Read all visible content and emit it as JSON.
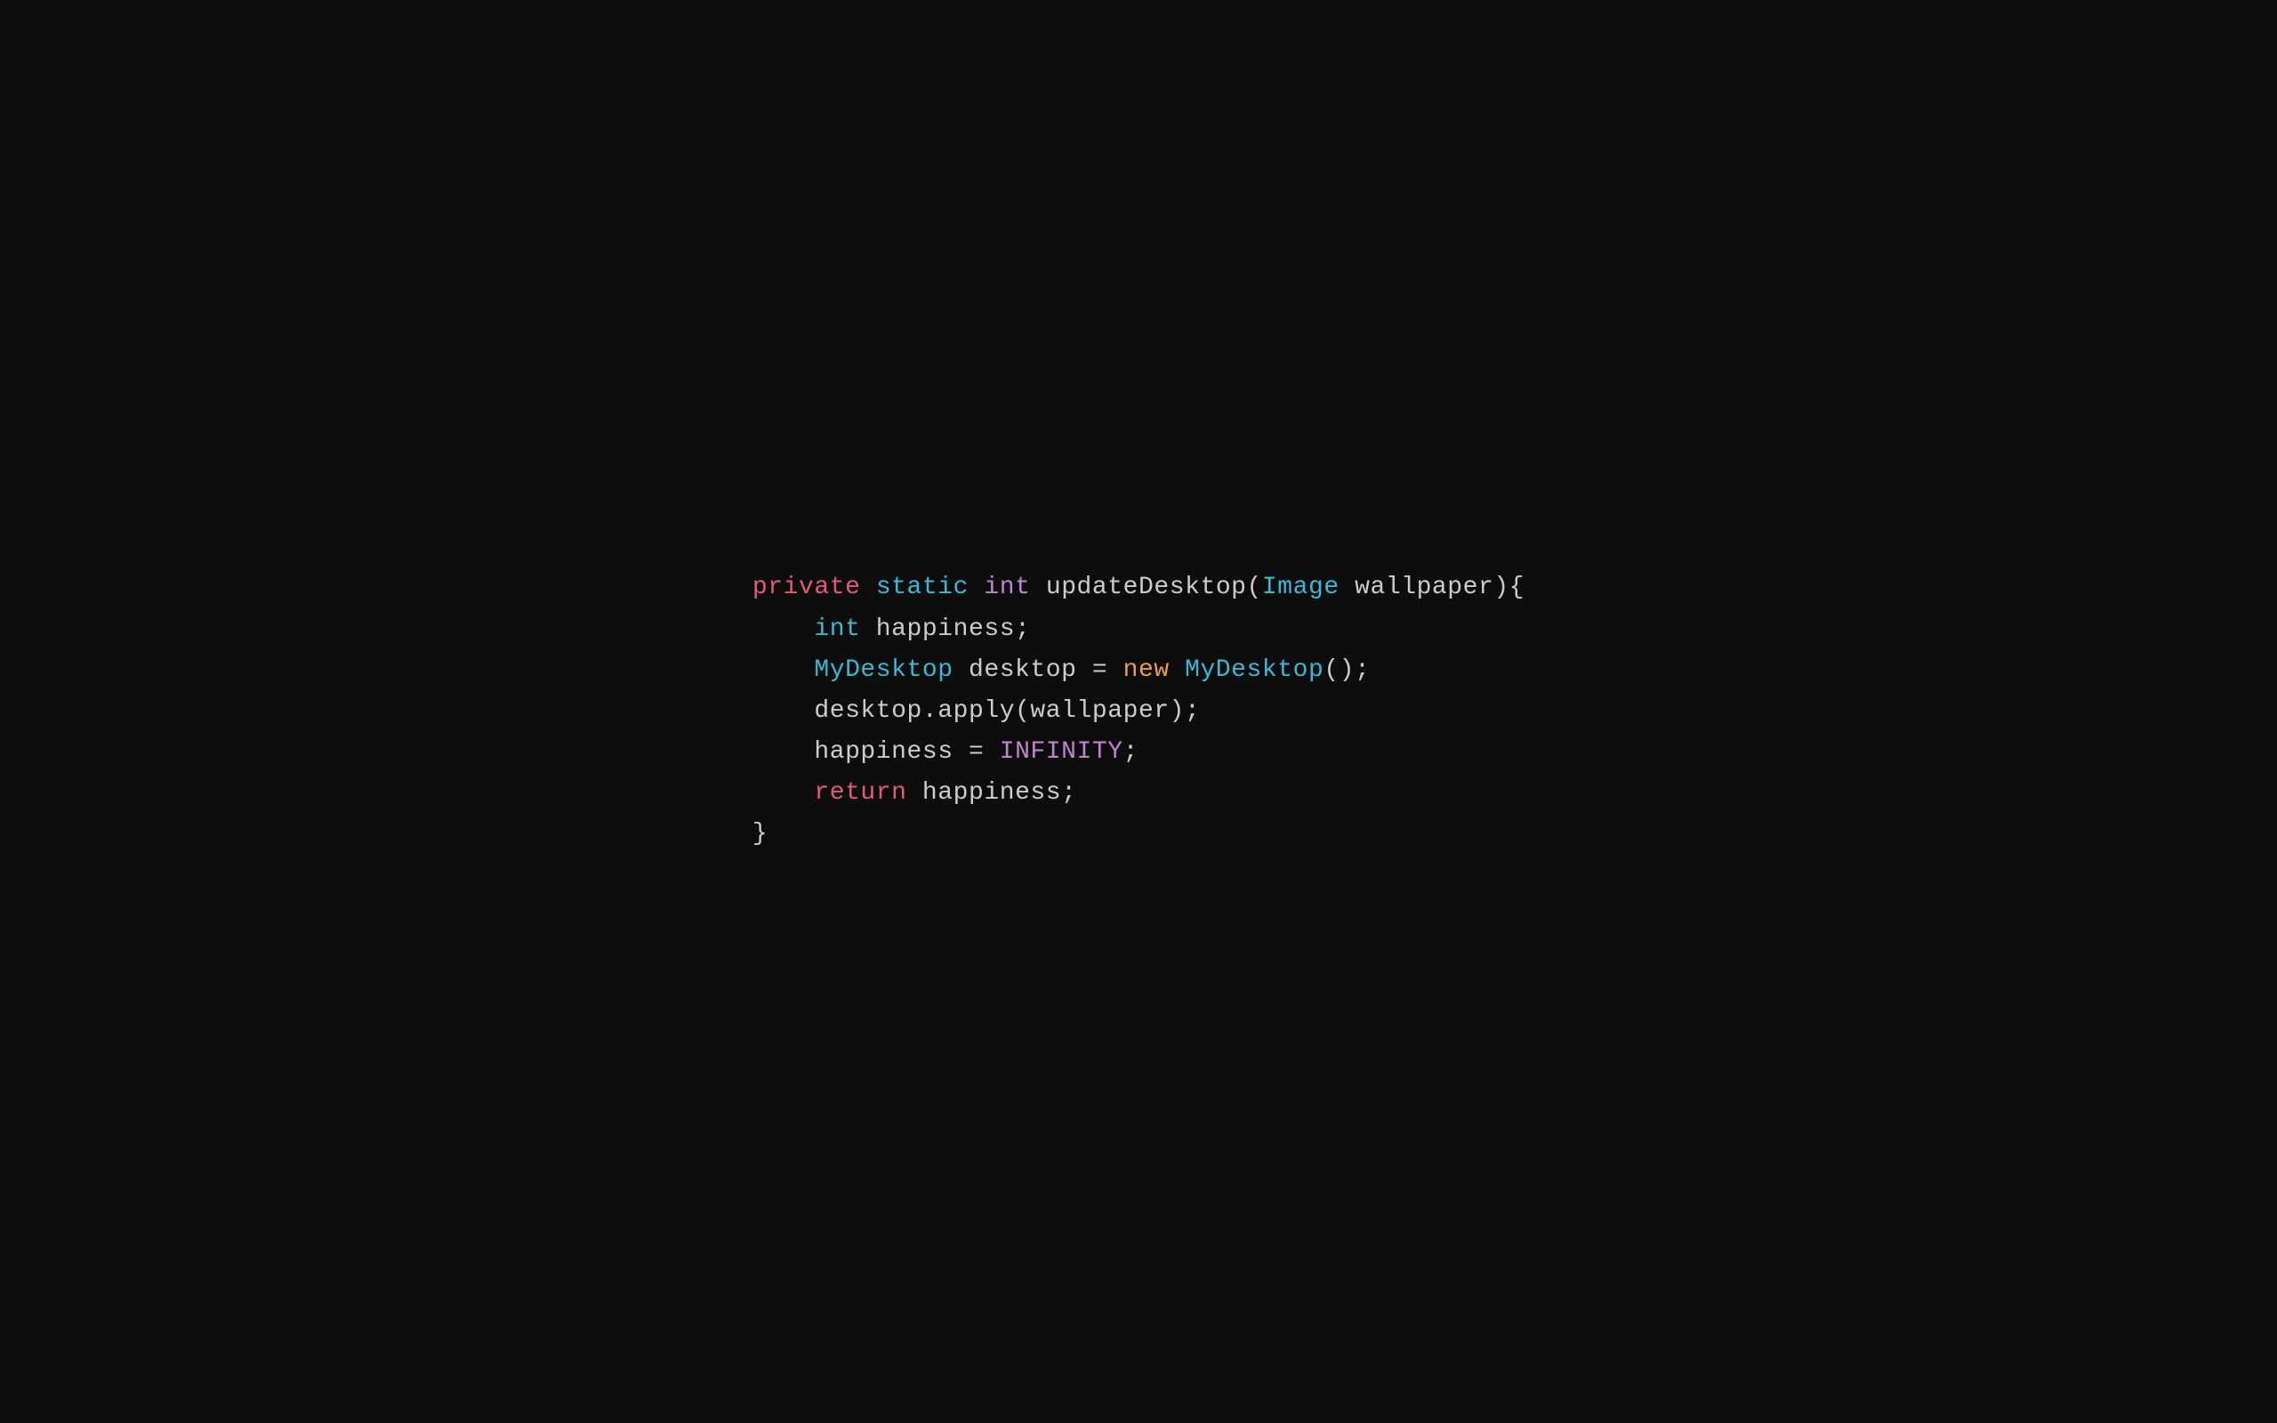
{
  "code": {
    "lines": [
      {
        "id": "line1",
        "parts": [
          {
            "text": "private",
            "cls": "kw-private"
          },
          {
            "text": " ",
            "cls": "plain"
          },
          {
            "text": "static",
            "cls": "kw-static"
          },
          {
            "text": " ",
            "cls": "plain"
          },
          {
            "text": "int",
            "cls": "kw-int"
          },
          {
            "text": " updateDesktop(",
            "cls": "plain"
          },
          {
            "text": "Image",
            "cls": "cls-image"
          },
          {
            "text": " wallpaper){",
            "cls": "plain"
          }
        ]
      },
      {
        "id": "line2",
        "parts": [
          {
            "text": "    ",
            "cls": "plain"
          },
          {
            "text": "int",
            "cls": "cls-mydesktop"
          },
          {
            "text": " happiness;",
            "cls": "plain"
          }
        ]
      },
      {
        "id": "line3",
        "parts": [
          {
            "text": "    ",
            "cls": "plain"
          },
          {
            "text": "MyDesktop",
            "cls": "cls-mydesktop"
          },
          {
            "text": " desktop = ",
            "cls": "plain"
          },
          {
            "text": "new",
            "cls": "kw-new"
          },
          {
            "text": " ",
            "cls": "plain"
          },
          {
            "text": "MyDesktop",
            "cls": "cls-mydesktop"
          },
          {
            "text": "();",
            "cls": "plain"
          }
        ]
      },
      {
        "id": "line4",
        "parts": [
          {
            "text": "    desktop.apply(wallpaper);",
            "cls": "plain"
          }
        ]
      },
      {
        "id": "line5",
        "parts": [
          {
            "text": "    happiness = ",
            "cls": "plain"
          },
          {
            "text": "INFINITY",
            "cls": "const-infinity"
          },
          {
            "text": ";",
            "cls": "plain"
          }
        ]
      },
      {
        "id": "line6",
        "parts": [
          {
            "text": "    ",
            "cls": "plain"
          },
          {
            "text": "return",
            "cls": "kw-return"
          },
          {
            "text": " happiness;",
            "cls": "plain"
          }
        ]
      },
      {
        "id": "line7",
        "parts": [
          {
            "text": "}",
            "cls": "plain"
          }
        ]
      }
    ]
  }
}
